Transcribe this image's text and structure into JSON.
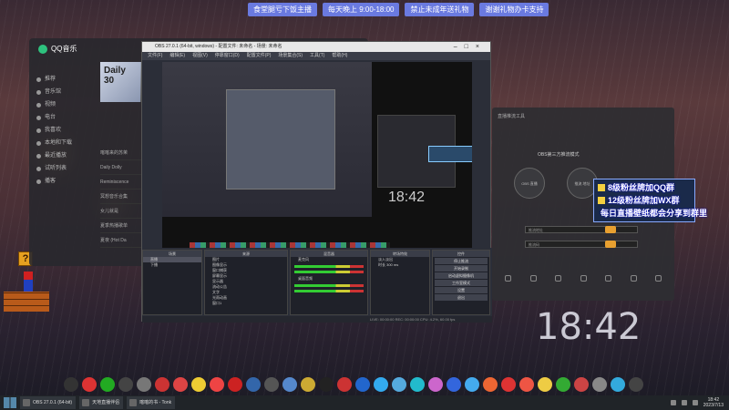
{
  "banner": [
    "食堂腿亏下饭主播",
    "每天晚上 9:00-18:00",
    "禁止未成年送礼物",
    "谢谢礼物办卡支持"
  ],
  "qq": {
    "title": "QQ音乐",
    "tile_text": "Daily 30",
    "side_items": [
      "推荐",
      "音乐馆",
      "视频",
      "电台",
      "我喜欢",
      "本地和下载",
      "最近播放",
      "试听列表",
      "播客"
    ],
    "list_items": [
      "喀喀来的苏茉",
      "Daily Dolly",
      "Reminiscence",
      "冥想音乐合集",
      "女儿就是",
      "夏季热播歌单",
      "夏夜 (Hot Da"
    ]
  },
  "obs": {
    "title": "OBS 27.0.1 (64-bit, windows) - 配置文件: 未命名 - 场景: 未命名",
    "menu": [
      "文件(F)",
      "编辑(E)",
      "视图(V)",
      "停靠窗口(D)",
      "配置文件(P)",
      "场景集合(S)",
      "工具(T)",
      "帮助(H)"
    ],
    "preview_clock": "18:42",
    "panels": {
      "scenes": {
        "header": "场景",
        "items": [
          "直播",
          "下播"
        ]
      },
      "sources": {
        "header": "来源",
        "items": [
          "图片",
          "图像显示",
          "窗口捕获",
          "屏幕显示",
          "显示器",
          "流动公告",
          "文字",
          "光雨动画",
          "窗口1"
        ]
      },
      "mixer": {
        "header": "混音器",
        "items": [
          "麦克风",
          "桌面音频"
        ]
      },
      "transitions": {
        "header": "转场特效",
        "items": [
          "淡入淡出",
          "时长 300 ms"
        ]
      },
      "controls": {
        "header": "控件",
        "buttons": [
          "停止推流",
          "开始录制",
          "启动虚拟摄像机",
          "工作室模式",
          "设置",
          "退出"
        ]
      }
    },
    "status": "LIVE: 00:00:00   REC: 00:00:00   CPU: 4.2%, 60.00 fps"
  },
  "app": {
    "header": "直播推流工具",
    "title": "OBS第三方推流模式",
    "circles": [
      "OBS 直播",
      "推流 地址"
    ],
    "inputs": [
      "推流地址",
      "推流码"
    ]
  },
  "notice": [
    "8级粉丝牌加QQ群",
    "12级粉丝牌加WX群",
    "每日直播壁纸都会分享到群里"
  ],
  "big_clock": "18:42",
  "taskbar": {
    "items": [
      "OBS 27.0.1 (64-bit)",
      "天地直播伴侣",
      "喀喀的书 - Tonk"
    ],
    "time": "18:42",
    "date": "2023/7/13"
  }
}
